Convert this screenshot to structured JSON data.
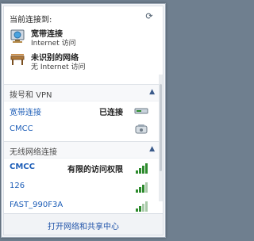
{
  "header": {
    "title": "当前连接到:",
    "refresh_icon": "refresh-icon"
  },
  "connected": [
    {
      "name": "宽带连接",
      "status": "Internet 访问",
      "icon": "globe-network-icon"
    },
    {
      "name": "未识别的网络",
      "status": "无 Internet 访问",
      "icon": "bench-network-icon"
    }
  ],
  "dialup_vpn": {
    "label": "拨号和 VPN",
    "items": [
      {
        "name": "宽带连接",
        "status": "已连接",
        "icon": "modem-icon"
      },
      {
        "name": "CMCC",
        "status": "",
        "icon": "phone-modem-icon"
      }
    ]
  },
  "wireless": {
    "label": "无线网络连接",
    "items": [
      {
        "name": "CMCC",
        "status": "有限的访问权限",
        "icon": "signal-icon"
      },
      {
        "name": "126",
        "status": "",
        "icon": "signal-icon"
      },
      {
        "name": "FAST_990F3A",
        "status": "",
        "icon": "signal-icon"
      }
    ]
  },
  "footer": {
    "link": "打开网络和共享中心"
  },
  "colors": {
    "link": "#1f5fb8",
    "accent": "#2e8b2e"
  }
}
